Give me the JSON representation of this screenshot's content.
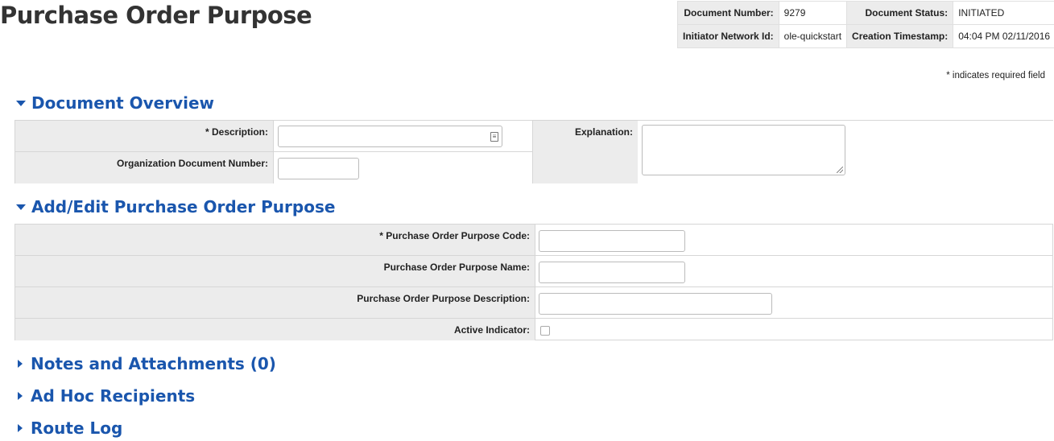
{
  "page": {
    "title": "Purchase Order Purpose"
  },
  "header_info": {
    "doc_number_label": "Document Number:",
    "doc_number": "9279",
    "doc_status_label": "Document Status:",
    "doc_status": "INITIATED",
    "initiator_label": "Initiator Network Id:",
    "initiator": "ole-quickstart",
    "timestamp_label": "Creation Timestamp:",
    "timestamp": "04:04 PM 02/11/2016"
  },
  "required_note": "* indicates required field",
  "document_overview": {
    "title": "Document Overview",
    "description_label": "* Description:",
    "description_value": "",
    "org_doc_number_label": "Organization Document Number:",
    "org_doc_number_value": "",
    "explanation_label": "Explanation:",
    "explanation_value": ""
  },
  "add_edit": {
    "title": "Add/Edit Purchase Order Purpose",
    "code_label": "* Purchase Order Purpose Code:",
    "code_value": "",
    "name_label": "Purchase Order Purpose Name:",
    "name_value": "",
    "description_label": "Purchase Order Purpose Description:",
    "description_value": "",
    "active_label": "Active Indicator:",
    "active_checked": false
  },
  "collapsed_sections": {
    "notes": "Notes and Attachments (0)",
    "adhoc": "Ad Hoc Recipients",
    "route_log": "Route Log"
  },
  "icons": {
    "expanded": "triangle-down-icon",
    "collapsed": "triangle-right-icon",
    "lookup": "lookup-icon",
    "resize": "resize-handle-icon"
  },
  "colors": {
    "accent": "#1a56ad",
    "label_bg": "#ececec",
    "border": "#d6d6d6"
  }
}
